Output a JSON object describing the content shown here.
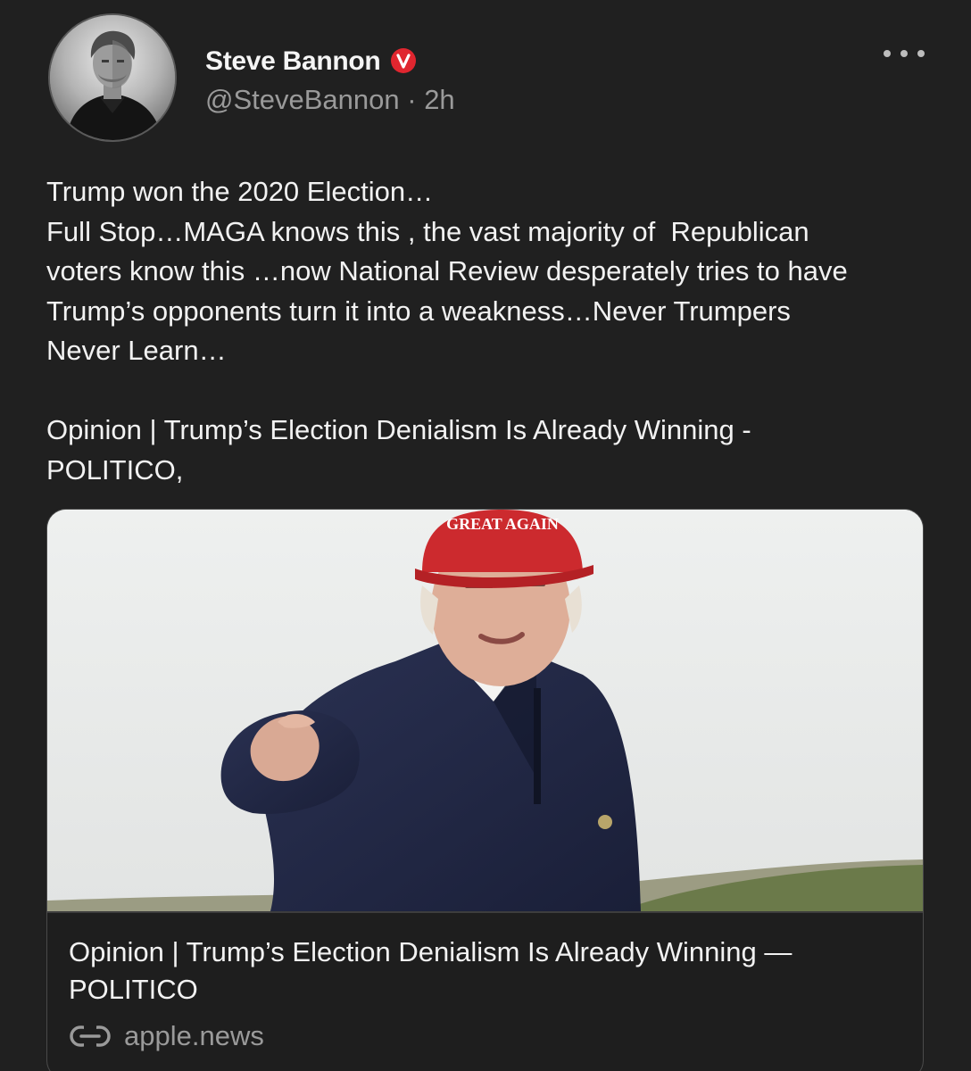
{
  "author": {
    "name": "Steve Bannon",
    "verified_badge_letter": "v",
    "handle": "@SteveBannon",
    "separator": " · ",
    "time": "2h"
  },
  "post": {
    "text": "Trump won the 2020 Election…\nFull Stop…MAGA knows this , the vast majority of  Republican\nvoters know this …now National Review desperately tries to have\nTrump’s opponents turn it into a weakness…Never Trumpers\nNever Learn…\n\nOpinion | Trump’s Election Denialism Is Already Winning -\nPOLITICO,"
  },
  "link_card": {
    "image_alt": "Man in red cap pointing",
    "cap_text": "GREAT AGAIN",
    "title": "Opinion | Trump’s Election Denialism Is Already Winning —\nPOLITICO",
    "domain": "apple.news"
  },
  "icons": {
    "more": "more-horizontal-icon",
    "verified": "verified-badge-icon",
    "link": "link-icon"
  },
  "colors": {
    "background": "#202020",
    "text_primary": "#f2f2f2",
    "text_secondary": "#9a9a9a",
    "verified_red": "#e0262f",
    "card_border": "#4a4a4a"
  }
}
